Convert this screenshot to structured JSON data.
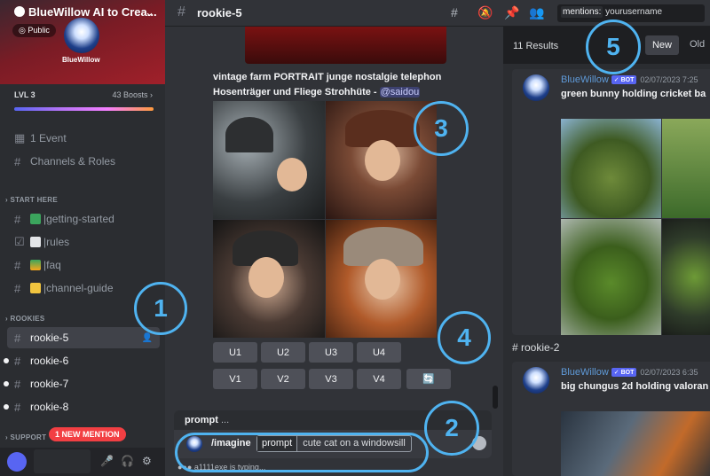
{
  "server": {
    "name": "BlueWillow AI to Crea...",
    "public_label": "Public",
    "logo_text": "BlueWillow",
    "level": "LVL 3",
    "boosts": "43 Boosts",
    "boosts_chevron": "›",
    "chevron": "⌄"
  },
  "sidebar": {
    "event": "1 Event",
    "channels_roles": "Channels & Roles",
    "start_here": "START HERE",
    "getting_started": "|getting-started",
    "rules": "|rules",
    "faq": "|faq",
    "channel_guide": "|channel-guide",
    "rookies": "ROOKIES",
    "rookie5": "rookie-5",
    "rookie6": "rookie-6",
    "rookie7": "rookie-7",
    "rookie8": "rookie-8",
    "support": "SUPPORT",
    "new_mention": "1 NEW MENTION"
  },
  "channel": {
    "name": "rookie-5"
  },
  "search": {
    "tag": "mentions:",
    "value": "yourusername"
  },
  "chat": {
    "caption_line1": "vintage farm PORTRAIT  junge nostalgie telephon",
    "caption_line2": "Hosenträger und Fliege  Strohhüte - ",
    "mention": "@saidou",
    "buttons_row1": [
      "U1",
      "U2",
      "U3",
      "U4"
    ],
    "buttons_row2": [
      "V1",
      "V2",
      "V3",
      "V4"
    ],
    "reroll_icon": "🔄",
    "prompt_hint": "prompt",
    "prompt_hint_more": "...",
    "command": "/imagine",
    "option_name": "prompt",
    "option_value": "cute cat on a windowsill",
    "typing": "a1111exe is typing..."
  },
  "results": {
    "count": "11 Results",
    "sort_new": "New",
    "sort_old": "Old",
    "card1": {
      "author": "BlueWillow",
      "bot": "✓ BOT",
      "time": "02/07/2023 7:25",
      "text": "green bunny holding cricket ba"
    },
    "channel2": "rookie-2",
    "card2": {
      "author": "BlueWillow",
      "bot": "✓ BOT",
      "time": "02/07/2023 6:35",
      "text": "big chungus 2d holding valoran"
    }
  },
  "annotations": [
    "1",
    "2",
    "3",
    "4",
    "5"
  ],
  "colors": {
    "annotation": "#4fb3f0",
    "mention_pill": "#f23f43",
    "bot_tag": "#5865f2"
  }
}
